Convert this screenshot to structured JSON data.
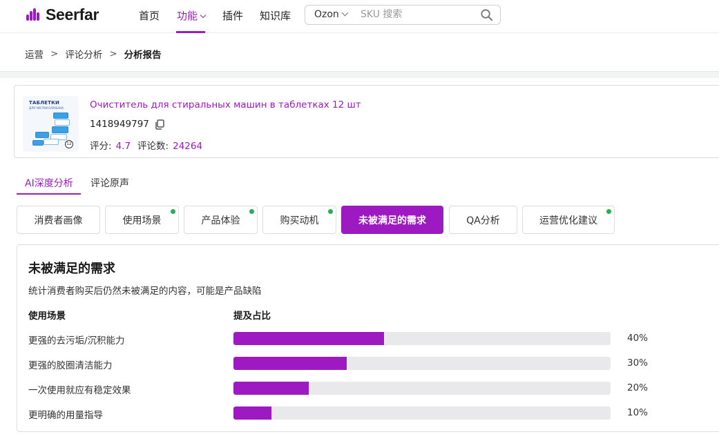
{
  "brand": {
    "name": "Seerfar",
    "accent": "#9d1ac2",
    "success_dot": "#22b14c"
  },
  "nav": {
    "items": [
      {
        "label": "首页"
      },
      {
        "label": "功能",
        "active": true,
        "has_dropdown": true
      },
      {
        "label": "插件"
      },
      {
        "label": "知识库"
      }
    ],
    "search": {
      "marketplace": "Ozon",
      "placeholder": "SKU 搜索",
      "value": ""
    }
  },
  "breadcrumb": [
    "运营",
    "评论分析",
    "分析报告"
  ],
  "product": {
    "image_text": "ТАБЛЕТКИ",
    "image_subtext": "ДЛЯ ЧИСТКИ БАРАБАНА",
    "image_badge": "12",
    "title": "Очиститель для стиральных машин в таблетках 12 шт",
    "sku": "1418949797",
    "rating_label": "评分:",
    "rating": "4.7",
    "reviews_label": "评论数:",
    "reviews": "24264"
  },
  "main_tabs": [
    {
      "label": "AI深度分析",
      "active": true
    },
    {
      "label": "评论原声"
    }
  ],
  "sub_tabs": [
    {
      "label": "消费者画像",
      "dot": false
    },
    {
      "label": "使用场景",
      "dot": true
    },
    {
      "label": "产品体验",
      "dot": true
    },
    {
      "label": "购买动机",
      "dot": true
    },
    {
      "label": "未被满足的需求",
      "active": true,
      "dot": false
    },
    {
      "label": "QA分析",
      "dot": false
    },
    {
      "label": "运营优化建议",
      "dot": true
    }
  ],
  "analysis": {
    "title": "未被满足的需求",
    "subtitle": "统计消费者购买后仍然未被满足的内容，可能是产品缺陷",
    "col_scene": "使用场景",
    "col_ratio": "提及占比",
    "rows": [
      {
        "label": "更强的去污垢/沉积能力",
        "pct_text": "40%",
        "pct": 40
      },
      {
        "label": "更强的胶圈清洁能力",
        "pct_text": "30%",
        "pct": 30
      },
      {
        "label": "一次使用就应有稳定效果",
        "pct_text": "20%",
        "pct": 20
      },
      {
        "label": "更明确的用量指导",
        "pct_text": "10%",
        "pct": 10
      }
    ]
  }
}
